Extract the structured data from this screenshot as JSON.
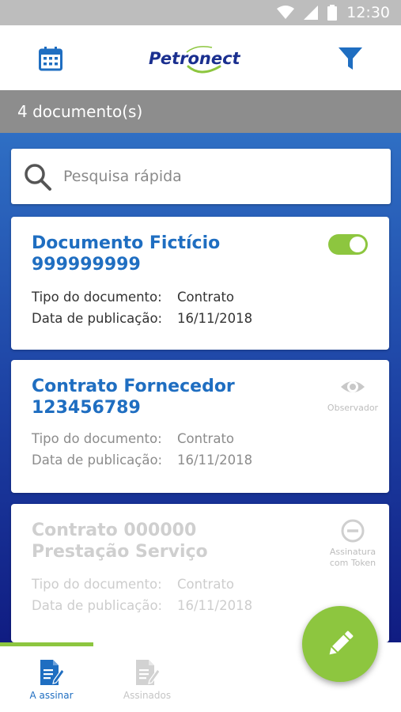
{
  "status_bar": {
    "time": "12:30",
    "icons": [
      "wifi-icon",
      "signal-icon",
      "battery-icon"
    ]
  },
  "header": {
    "logo_text": "Petronect",
    "left_icon": "calendar-icon",
    "right_icon": "filter-icon"
  },
  "count_bar": {
    "text": "4 documento(s)"
  },
  "search": {
    "placeholder": "Pesquisa rápida",
    "value": "",
    "icon": "search-icon"
  },
  "documents": [
    {
      "title_line1": "Documento Fictício",
      "title_line2": "999999999",
      "type_label": "Tipo do documento:",
      "type_value": "Contrato",
      "date_label": "Data de publicação:",
      "date_value": "16/11/2018",
      "status": "toggle-on"
    },
    {
      "title_line1": "Contrato Fornecedor",
      "title_line2": "123456789",
      "type_label": "Tipo do documento:",
      "type_value": "Contrato",
      "date_label": "Data de publicação:",
      "date_value": "16/11/2018",
      "status_icon": "eye-icon",
      "status_label": "Observador"
    },
    {
      "title_line1": "Contrato 000000",
      "title_line2": "Prestação Serviço",
      "type_label": "Tipo do documento:",
      "type_value": "Contrato",
      "date_label": "Data de publicação:",
      "date_value": "16/11/2018",
      "status_icon": "minus-circle-icon",
      "status_label_line1": "Assinatura",
      "status_label_line2": "com Token"
    }
  ],
  "bottom_nav": {
    "items": [
      {
        "label": "A assinar",
        "icon": "sign-document-icon",
        "active": true
      },
      {
        "label": "Assinados",
        "icon": "signed-document-icon",
        "active": false
      }
    ]
  },
  "fab": {
    "icon": "pencil-icon"
  },
  "colors": {
    "accent_green": "#8dc63f",
    "title_blue": "#1f6ec1",
    "count_bar_gray": "#8d8d8d",
    "gradient_top": "#2f6fc4",
    "gradient_bottom": "#101c82"
  }
}
